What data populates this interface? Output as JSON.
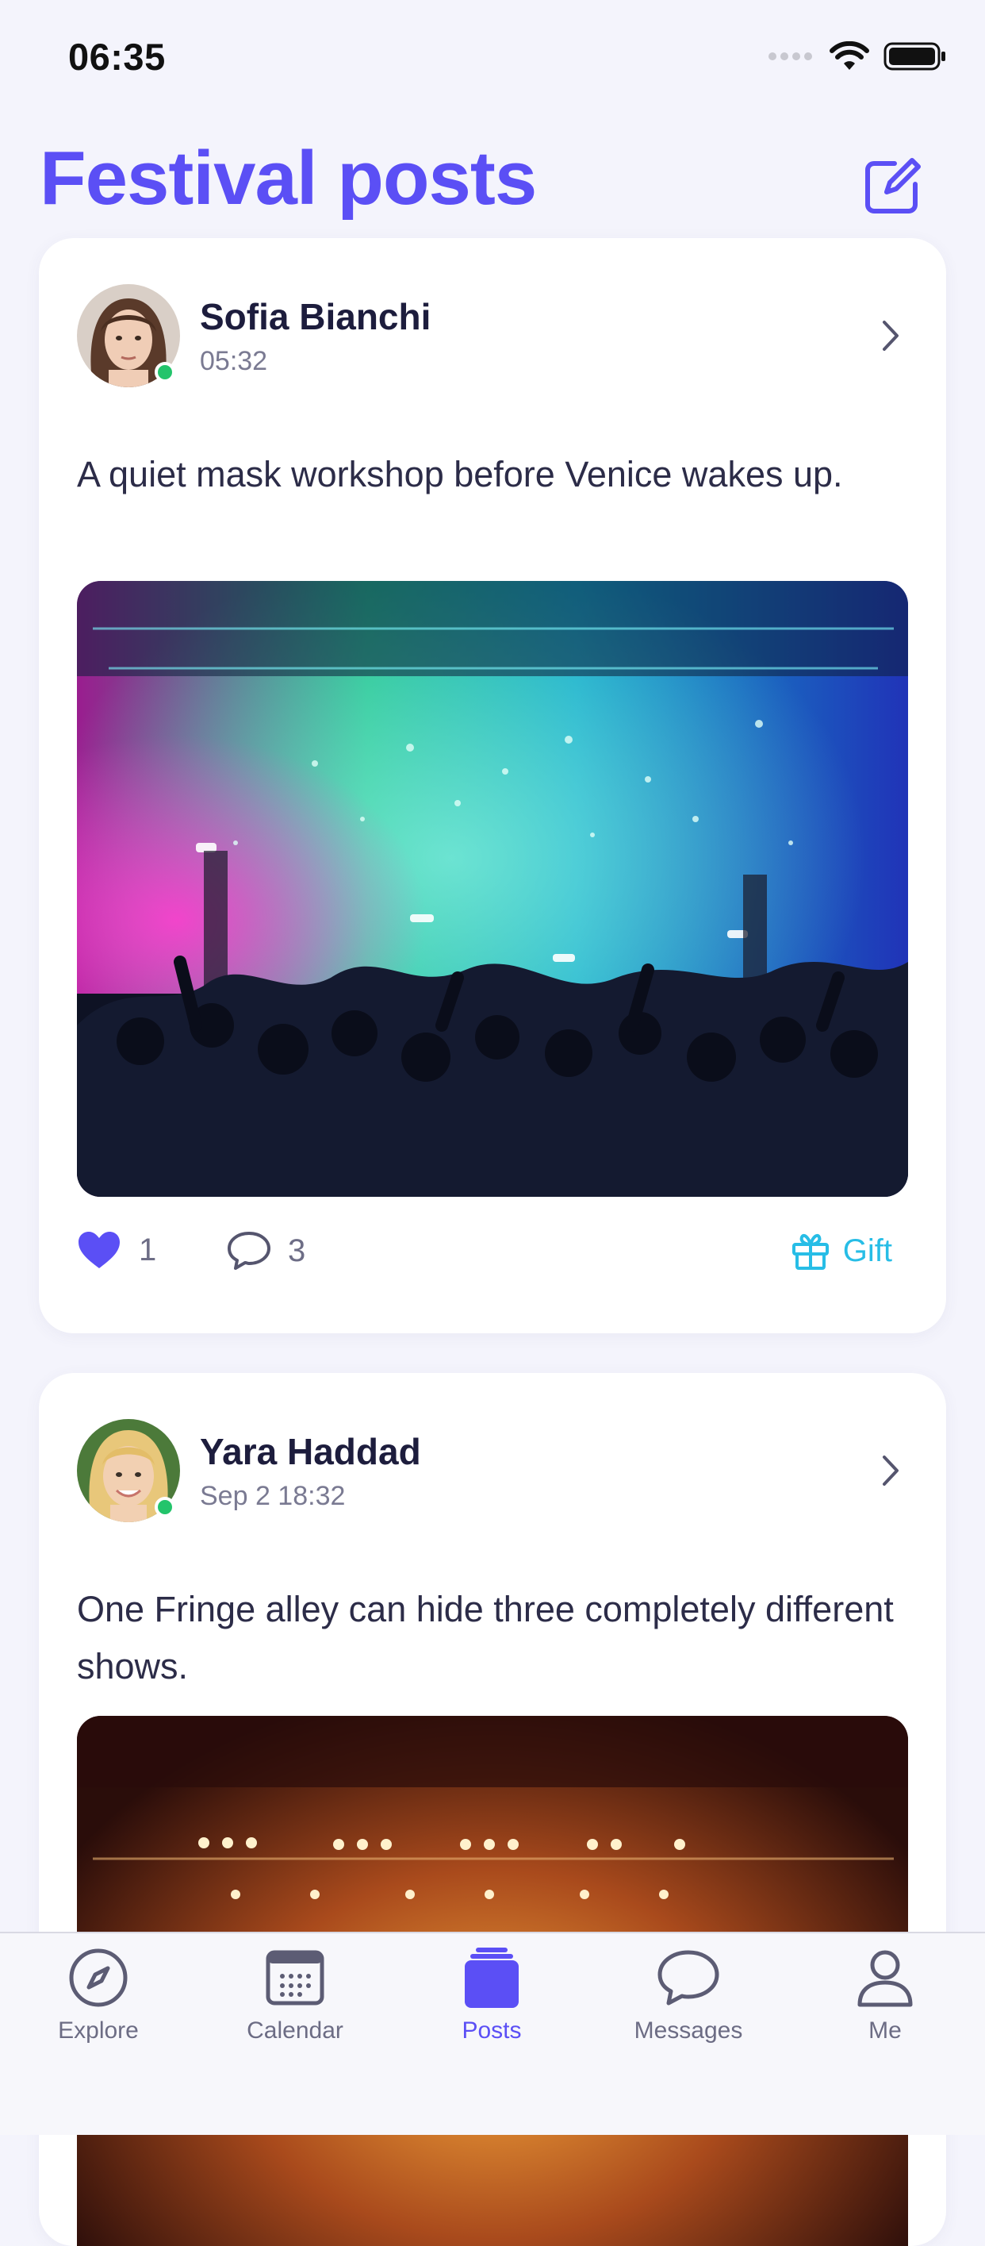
{
  "status": {
    "time": "06:35"
  },
  "header": {
    "title": "Festival posts",
    "compose_icon": "compose-icon"
  },
  "posts": [
    {
      "author": "Sofia Bianchi",
      "time": "05:32",
      "text": "A quiet mask workshop before Venice wakes up.",
      "likes": "1",
      "comments": "3",
      "gift_label": "Gift",
      "online": true,
      "image": "concert crowd with colorful stage lights"
    },
    {
      "author": "Yara Haddad",
      "time": "Sep 2 18:32",
      "text": "One Fringe alley can hide three completely different shows.",
      "online": true,
      "image": "stage with warm amber lights and smoke"
    }
  ],
  "tabs": [
    {
      "label": "Explore",
      "icon": "compass-icon",
      "active": false
    },
    {
      "label": "Calendar",
      "icon": "calendar-icon",
      "active": false
    },
    {
      "label": "Posts",
      "icon": "posts-icon",
      "active": true
    },
    {
      "label": "Messages",
      "icon": "chat-bubble-icon",
      "active": false
    },
    {
      "label": "Me",
      "icon": "person-icon",
      "active": false
    }
  ],
  "colors": {
    "accent": "#5b4ff5",
    "gift": "#27bde6",
    "online": "#23c46b",
    "background": "#f4f4fc"
  }
}
